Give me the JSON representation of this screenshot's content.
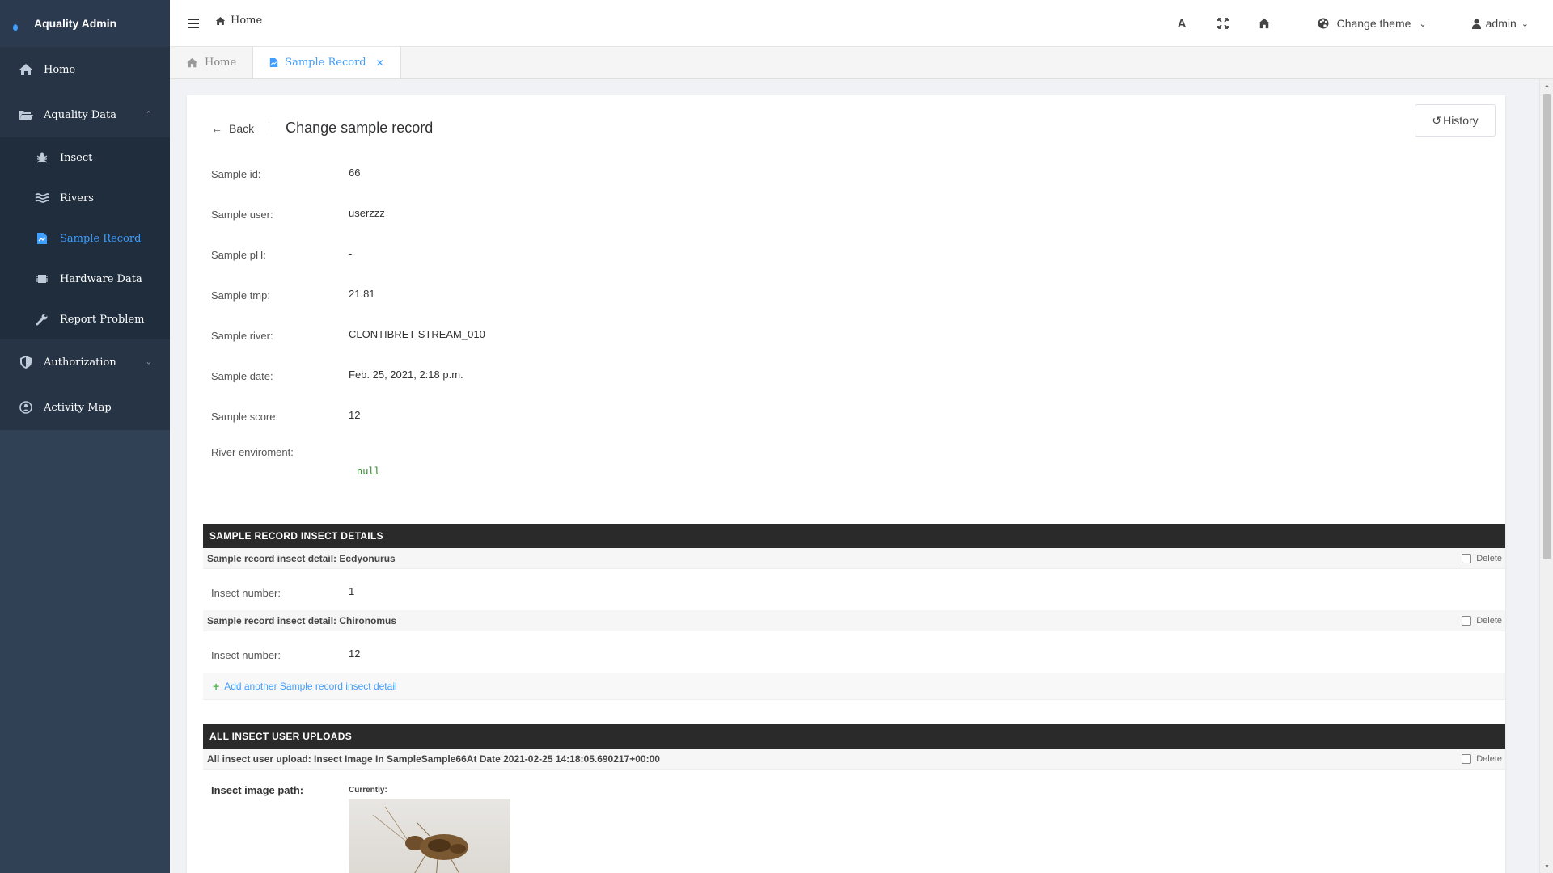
{
  "app": {
    "title": "Aquality Admin"
  },
  "sidebar": {
    "items": [
      {
        "label": "Home",
        "icon": "home-icon"
      },
      {
        "label": "Aquality Data",
        "icon": "folder-open-icon"
      },
      {
        "label": "Authorization",
        "icon": "shield-icon"
      },
      {
        "label": "Activity Map",
        "icon": "map-icon"
      }
    ],
    "submenu": [
      {
        "label": "Insect",
        "icon": "bug-icon"
      },
      {
        "label": "Rivers",
        "icon": "water-icon"
      },
      {
        "label": "Sample Record",
        "icon": "file-chart-icon"
      },
      {
        "label": "Hardware Data",
        "icon": "chip-icon"
      },
      {
        "label": "Report Problem",
        "icon": "wrench-icon"
      }
    ]
  },
  "topbar": {
    "breadcrumb": "Home",
    "font_icon_label": "A",
    "theme_label": "Change theme",
    "user_label": "admin"
  },
  "tabs": [
    {
      "label": "Home"
    },
    {
      "label": "Sample Record"
    }
  ],
  "page": {
    "back_label": "Back",
    "title": "Change sample record",
    "history_label": "History"
  },
  "fields": [
    {
      "label": "Sample id:",
      "value": "66"
    },
    {
      "label": "Sample user:",
      "value": "userzzz"
    },
    {
      "label": "Sample pH:",
      "value": "-"
    },
    {
      "label": "Sample tmp:",
      "value": "21.81"
    },
    {
      "label": "Sample river:",
      "value": "CLONTIBRET STREAM_010"
    },
    {
      "label": "Sample date:",
      "value": "Feb. 25, 2021, 2:18 p.m."
    },
    {
      "label": "Sample score:",
      "value": "12"
    }
  ],
  "river_env": {
    "label": "River enviroment:",
    "value": "null"
  },
  "insect_details": {
    "header": "SAMPLE RECORD INSECT DETAILS",
    "rows": [
      {
        "title": "Sample record insect detail: Ecdyonurus",
        "label": "Insect number:",
        "value": "1"
      },
      {
        "title": "Sample record insect detail: Chironomus",
        "label": "Insect number:",
        "value": "12"
      }
    ],
    "delete_label": "Delete",
    "add_label": "Add another Sample record insect detail"
  },
  "uploads": {
    "header": "ALL INSECT USER UPLOADS",
    "title": "All insect user upload: Insect Image In SampleSample66At Date 2021-02-25 14:18:05.690217+00:00",
    "delete_label": "Delete",
    "path_label": "Insect image path:",
    "currently_label": "Currently:"
  },
  "colors": {
    "sidebar_bg": "#304156",
    "accent": "#409eff",
    "header_bar": "#2a2a2a"
  }
}
